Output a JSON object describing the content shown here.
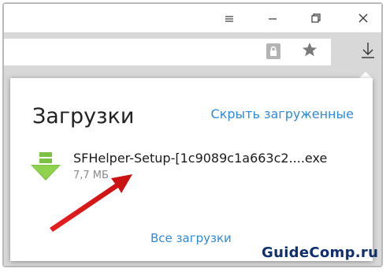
{
  "popup": {
    "title": "Загрузки",
    "hide_link": "Скрыть загруженные",
    "all_link": "Все загрузки"
  },
  "download": {
    "filename": "SFHelper-Setup-[1c9089c1a663c2....exe",
    "size": "7,7 МБ"
  },
  "watermark": "GuideComp.ru",
  "colors": {
    "link": "#2f8ad8",
    "download_arrow": "#7cc242",
    "annotation_arrow": "#e02020"
  },
  "icons": [
    "minimize-icon",
    "restore-icon",
    "close-icon",
    "lock-icon",
    "star-icon",
    "download-icon",
    "file-download-icon"
  ]
}
